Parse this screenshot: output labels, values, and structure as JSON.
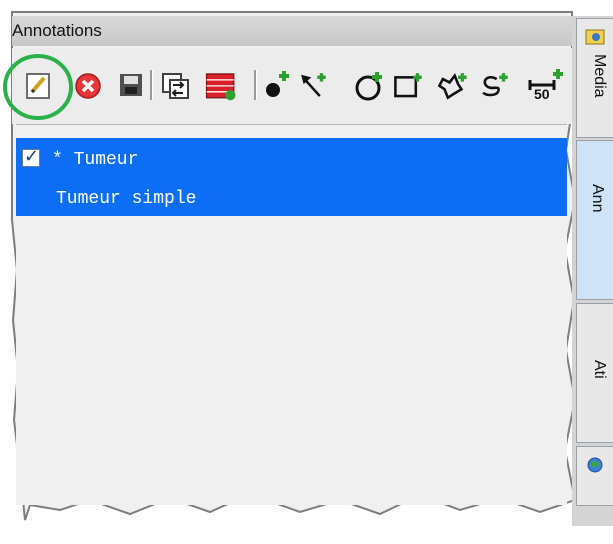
{
  "panel": {
    "title": "Annotations"
  },
  "toolbar": {
    "items": [
      {
        "name": "edit-annotation-icon"
      },
      {
        "name": "delete-annotation-icon"
      },
      {
        "name": "save-annotation-icon"
      },
      {
        "name": "swap-annotation-icon"
      },
      {
        "name": "annotation-table-icon"
      },
      {
        "name": "add-point-icon"
      },
      {
        "name": "add-arrow-icon"
      },
      {
        "name": "add-circle-icon"
      },
      {
        "name": "add-rectangle-icon"
      },
      {
        "name": "add-polygon-icon"
      },
      {
        "name": "add-freehand-icon"
      },
      {
        "name": "add-ruler-icon"
      }
    ],
    "ruler_badge": "50"
  },
  "annotations": [
    {
      "name": "* Tumeur",
      "description": "Tumeur simple",
      "checked": true
    }
  ],
  "side_tabs": [
    {
      "label": "Media",
      "active": false
    },
    {
      "label": "Ann",
      "active": true
    },
    {
      "label": "Ati",
      "active": false
    },
    {
      "label": "",
      "active": false
    }
  ],
  "colors": {
    "selection": "#0d6ef5",
    "highlight_circle": "#2bb04a",
    "add_badge": "#2ea02e"
  }
}
